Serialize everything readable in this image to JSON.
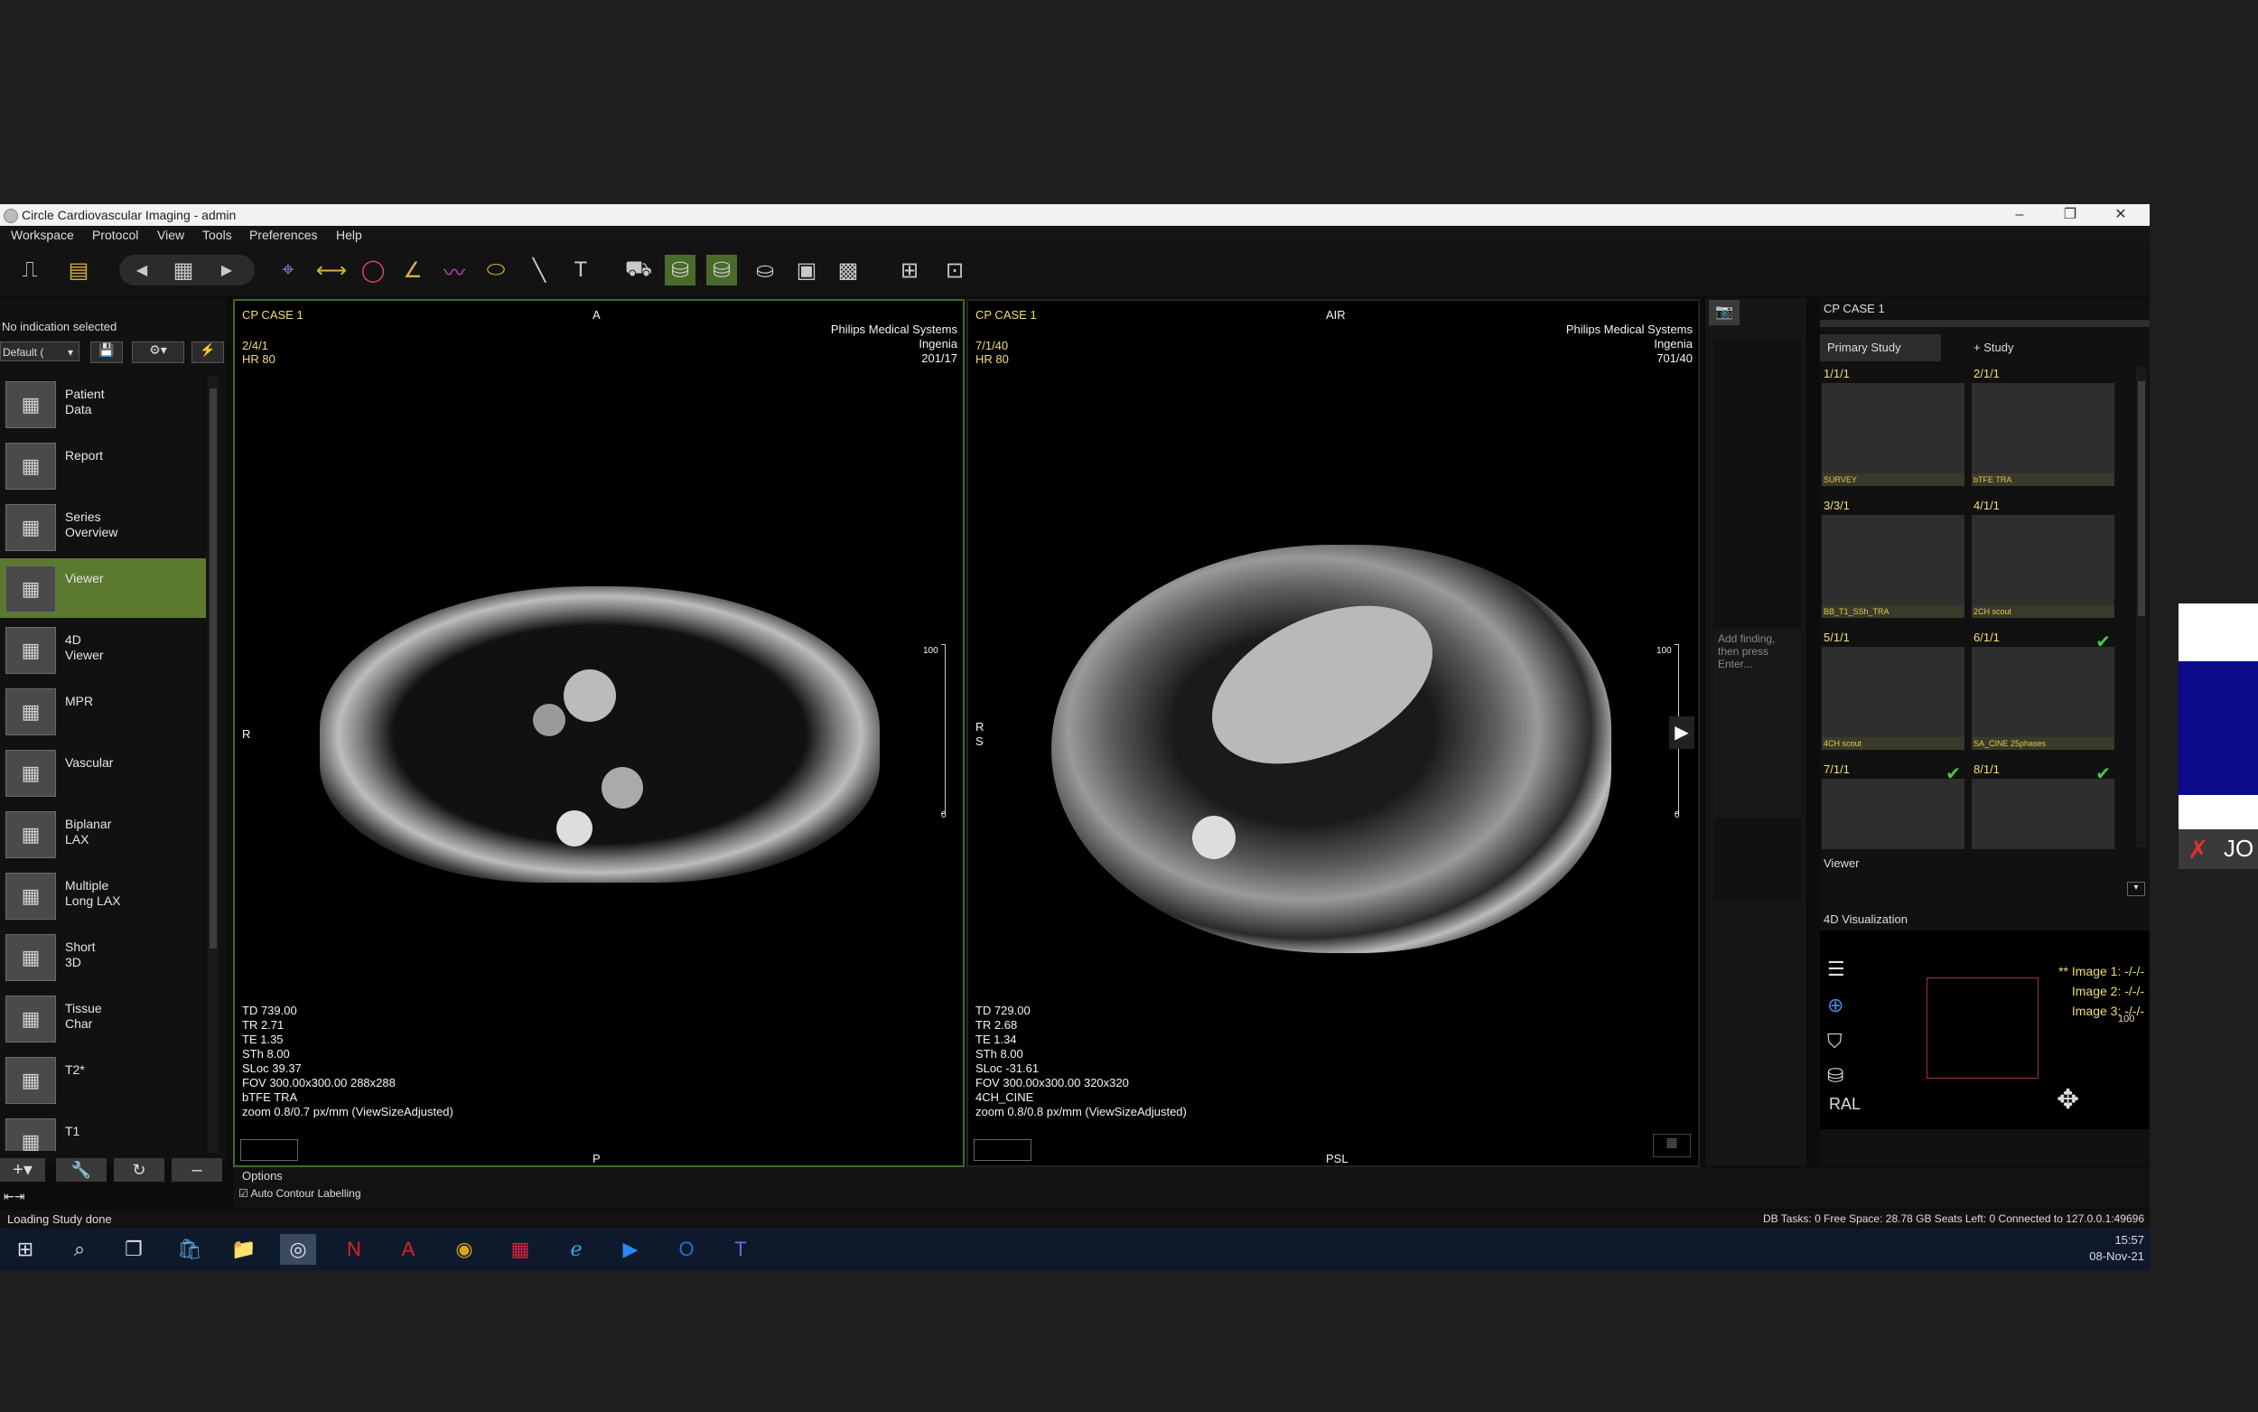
{
  "window": {
    "title": "Circle Cardiovascular Imaging - admin",
    "minimize": "–",
    "restore": "❐",
    "close": "✕"
  },
  "menu": [
    "Workspace",
    "Protocol",
    "View",
    "Tools",
    "Preferences",
    "Help"
  ],
  "sidebar": {
    "indication": "No indication selected",
    "preset": "Default (",
    "items": [
      {
        "label": "Patient\nData",
        "icon": "patient-data-icon"
      },
      {
        "label": "Report",
        "icon": "report-icon"
      },
      {
        "label": "Series\nOverview",
        "icon": "series-overview-icon"
      },
      {
        "label": "Viewer",
        "icon": "viewer-icon"
      },
      {
        "label": "4D\nViewer",
        "icon": "4d-viewer-icon"
      },
      {
        "label": "MPR",
        "icon": "mpr-icon"
      },
      {
        "label": "Vascular",
        "icon": "vascular-icon"
      },
      {
        "label": "Biplanar\nLAX",
        "icon": "biplanar-lax-icon"
      },
      {
        "label": "Multiple\nLong LAX",
        "icon": "multiple-long-lax-icon"
      },
      {
        "label": "Short\n3D",
        "icon": "short-3d-icon"
      },
      {
        "label": "Tissue\nChar",
        "icon": "tissue-char-icon"
      },
      {
        "label": "T2*",
        "icon": "t2star-icon"
      },
      {
        "label": "T1",
        "icon": "t1-icon"
      }
    ],
    "active_index": 3
  },
  "viewport_left": {
    "case": "CP CASE 1",
    "orient_top": "A",
    "orient_bottom": "P",
    "orient_left": "R",
    "series_line1": "2/4/1",
    "series_line2": "HR 80",
    "vendor1": "Philips Medical Systems",
    "vendor2": "Ingenia",
    "vendor3": "201/17",
    "scale_top": "100",
    "scale_bottom": "0",
    "params": [
      "TD 739.00",
      "TR 2.71",
      "TE 1.35",
      "STh 8.00",
      "SLoc 39.37",
      "FOV 300.00x300.00 288x288",
      "bTFE TRA",
      "zoom 0.8/0.7 px/mm (ViewSizeAdjusted)"
    ]
  },
  "viewport_right": {
    "case": "CP CASE 1",
    "orient_top": "AIR",
    "orient_bottom": "PSL",
    "orient_left": "R\nS",
    "series_line1": "7/1/40",
    "series_line2": "HR 80",
    "vendor1": "Philips Medical Systems",
    "vendor2": "Ingenia",
    "vendor3": "701/40",
    "scale_top": "100",
    "scale_bottom": "0",
    "params": [
      "TD 729.00",
      "TR 2.68",
      "TE 1.34",
      "STh 8.00",
      "SLoc -31.61",
      "FOV 300.00x300.00 320x320",
      "4CH_CINE",
      "zoom 0.8/0.8 px/mm (ViewSizeAdjusted)"
    ]
  },
  "findings": {
    "placeholder": "Add finding,\nthen press\nEnter..."
  },
  "study_panel": {
    "title": "CP CASE 1",
    "tabs": [
      "Primary Study",
      "+ Study"
    ],
    "thumbs": [
      {
        "num": "1/1/1",
        "cap": "SURVEY",
        "check": false
      },
      {
        "num": "2/1/1",
        "cap": "bTFE TRA",
        "check": false
      },
      {
        "num": "3/3/1",
        "cap": "BB_T1_SSh_TRA",
        "check": false
      },
      {
        "num": "4/1/1",
        "cap": "2CH scout",
        "check": false
      },
      {
        "num": "5/1/1",
        "cap": "4CH scout",
        "check": false
      },
      {
        "num": "6/1/1",
        "cap": "SA_CINE 25phases",
        "check": true
      },
      {
        "num": "7/1/1",
        "cap": "",
        "check": true
      },
      {
        "num": "8/1/1",
        "cap": "",
        "check": true
      }
    ],
    "viewer_label": "Viewer",
    "viz_title": "4D Visualization",
    "viz_labels": [
      "** Image 1: -/-/-",
      "Image 2: -/-/-",
      "Image 3: -/-/-"
    ],
    "viz_scale": "100",
    "viz_orient": "RAL"
  },
  "options": {
    "title": "Options",
    "auto_contour": "Auto Contour Labelling"
  },
  "status": {
    "left": "Loading Study done",
    "right": "DB Tasks: 0   Free Space: 28.78 GB   Seats Left: 0   Connected to 127.0.0.1:49696"
  },
  "taskbar": {
    "time": "15:57",
    "date": "08-Nov-21"
  },
  "overlay_text": "JO",
  "colors": {
    "active_green": "#5b7a30",
    "yellow_text": "#f0de7a",
    "viewport_border": "#3d6a2a"
  }
}
